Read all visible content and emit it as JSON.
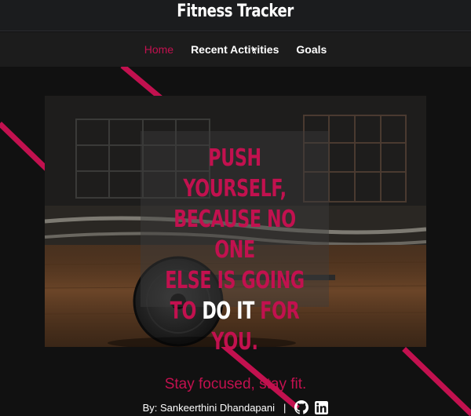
{
  "app": {
    "title": "Fitness Tracker"
  },
  "nav": {
    "items": [
      {
        "label": "Home",
        "active": true
      },
      {
        "label": "Recent Activities",
        "active": false
      },
      {
        "label": "Goals",
        "active": false
      }
    ]
  },
  "hero": {
    "quote_lines": [
      "PUSH YOURSELF,",
      "BECAUSE NO ONE",
      "ELSE IS GOING"
    ],
    "quote_line4_pre": "TO",
    "quote_line4_emph": "DO IT",
    "quote_line4_post": "FOR",
    "quote_line5": "YOU."
  },
  "tagline": "Stay focused, stay fit.",
  "footer": {
    "byline": "By: Sankeerthini Dhandapani",
    "separator": "|",
    "icons": [
      "github-icon",
      "linkedin-icon"
    ]
  },
  "colors": {
    "accent": "#c2114f",
    "background": "#111111",
    "header": "#1b1c1e"
  }
}
